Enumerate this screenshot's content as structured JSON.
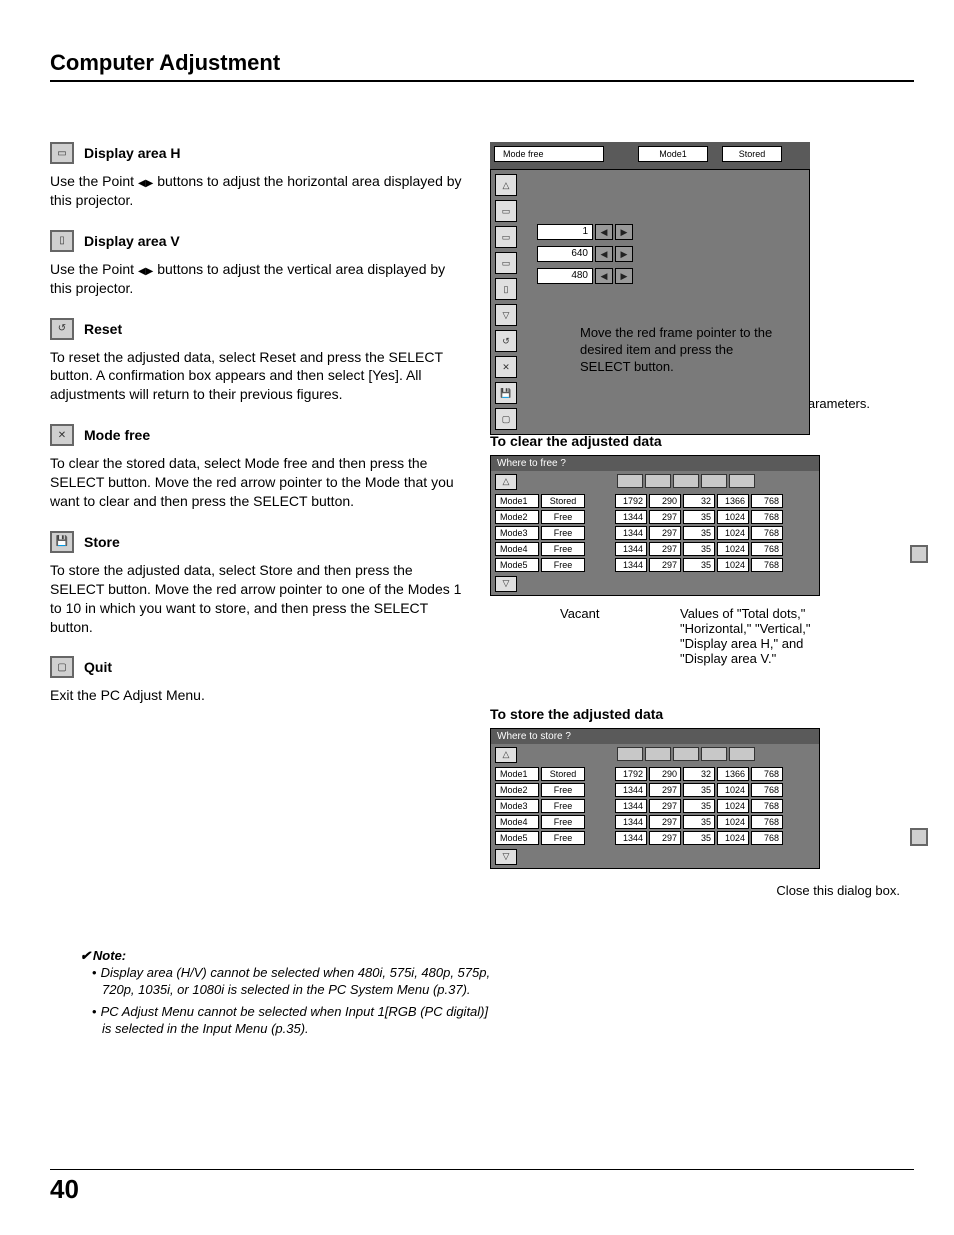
{
  "page": {
    "title": "Computer Adjustment",
    "number": "40"
  },
  "sections": {
    "displayH": {
      "title": "Display area H",
      "body_a": "Use the Point ",
      "body_b": " buttons to adjust the horizontal area displayed by this projector."
    },
    "displayV": {
      "title": "Display area V",
      "body_a": "Use the Point ",
      "body_b": " buttons to adjust the vertical area displayed by this projector."
    },
    "reset": {
      "title": "Reset",
      "body": "To reset the adjusted data, select Reset and press the SELECT button. A confirmation box appears and then select [Yes]. All adjustments will return to their previous figures."
    },
    "modefree": {
      "title": "Mode free",
      "body": "To clear the stored data, select Mode free and then press the SELECT button. Move the red arrow pointer to the Mode that you want to clear and then press the SELECT button."
    },
    "store": {
      "title": "Store",
      "body": "To store the adjusted data, select Store and then press the SELECT button. Move the red arrow pointer to one of the Modes 1 to 10 in which you want to store, and then press the SELECT button."
    },
    "quit": {
      "title": "Quit",
      "body": "Exit the PC Adjust Menu."
    }
  },
  "osd": {
    "tab1": "Mode free",
    "tab2": "Mode1",
    "tab3": "Stored",
    "values": {
      "v1": "1",
      "v2": "640",
      "v3": "480"
    },
    "note": "Move the red frame pointer to the desired item and press the SELECT button."
  },
  "right": {
    "modeNote": "This Mode has stored parameters.",
    "clearHeading": "To clear the adjusted data",
    "storeHeading": "To store the adjusted data",
    "closeNote": "Close this dialog box."
  },
  "clearTable": {
    "title": "Where to free ?",
    "rows": [
      {
        "mode": "Mode1",
        "status": "Stored",
        "v": [
          "1792",
          "290",
          "32",
          "1366",
          "768"
        ]
      },
      {
        "mode": "Mode2",
        "status": "Free",
        "v": [
          "1344",
          "297",
          "35",
          "1024",
          "768"
        ]
      },
      {
        "mode": "Mode3",
        "status": "Free",
        "v": [
          "1344",
          "297",
          "35",
          "1024",
          "768"
        ]
      },
      {
        "mode": "Mode4",
        "status": "Free",
        "v": [
          "1344",
          "297",
          "35",
          "1024",
          "768"
        ]
      },
      {
        "mode": "Mode5",
        "status": "Free",
        "v": [
          "1344",
          "297",
          "35",
          "1024",
          "768"
        ]
      }
    ],
    "callout_l": "Vacant",
    "callout_r": "Values of \"Total dots,\" \"Horizontal,\" \"Vertical,\" \"Display area H,\" and \"Display area V.\""
  },
  "storeTable": {
    "title": "Where to store ?",
    "rows": [
      {
        "mode": "Mode1",
        "status": "Stored",
        "v": [
          "1792",
          "290",
          "32",
          "1366",
          "768"
        ]
      },
      {
        "mode": "Mode2",
        "status": "Free",
        "v": [
          "1344",
          "297",
          "35",
          "1024",
          "768"
        ]
      },
      {
        "mode": "Mode3",
        "status": "Free",
        "v": [
          "1344",
          "297",
          "35",
          "1024",
          "768"
        ]
      },
      {
        "mode": "Mode4",
        "status": "Free",
        "v": [
          "1344",
          "297",
          "35",
          "1024",
          "768"
        ]
      },
      {
        "mode": "Mode5",
        "status": "Free",
        "v": [
          "1344",
          "297",
          "35",
          "1024",
          "768"
        ]
      }
    ]
  },
  "note": {
    "heading": "Note:",
    "items": [
      "Display area (H/V) cannot be selected when 480i, 575i, 480p, 575p, 720p, 1035i, or 1080i is selected in the PC System Menu (p.37).",
      "PC Adjust Menu cannot be selected when Input 1[RGB (PC digital)] is selected in the Input Menu (p.35)."
    ]
  }
}
